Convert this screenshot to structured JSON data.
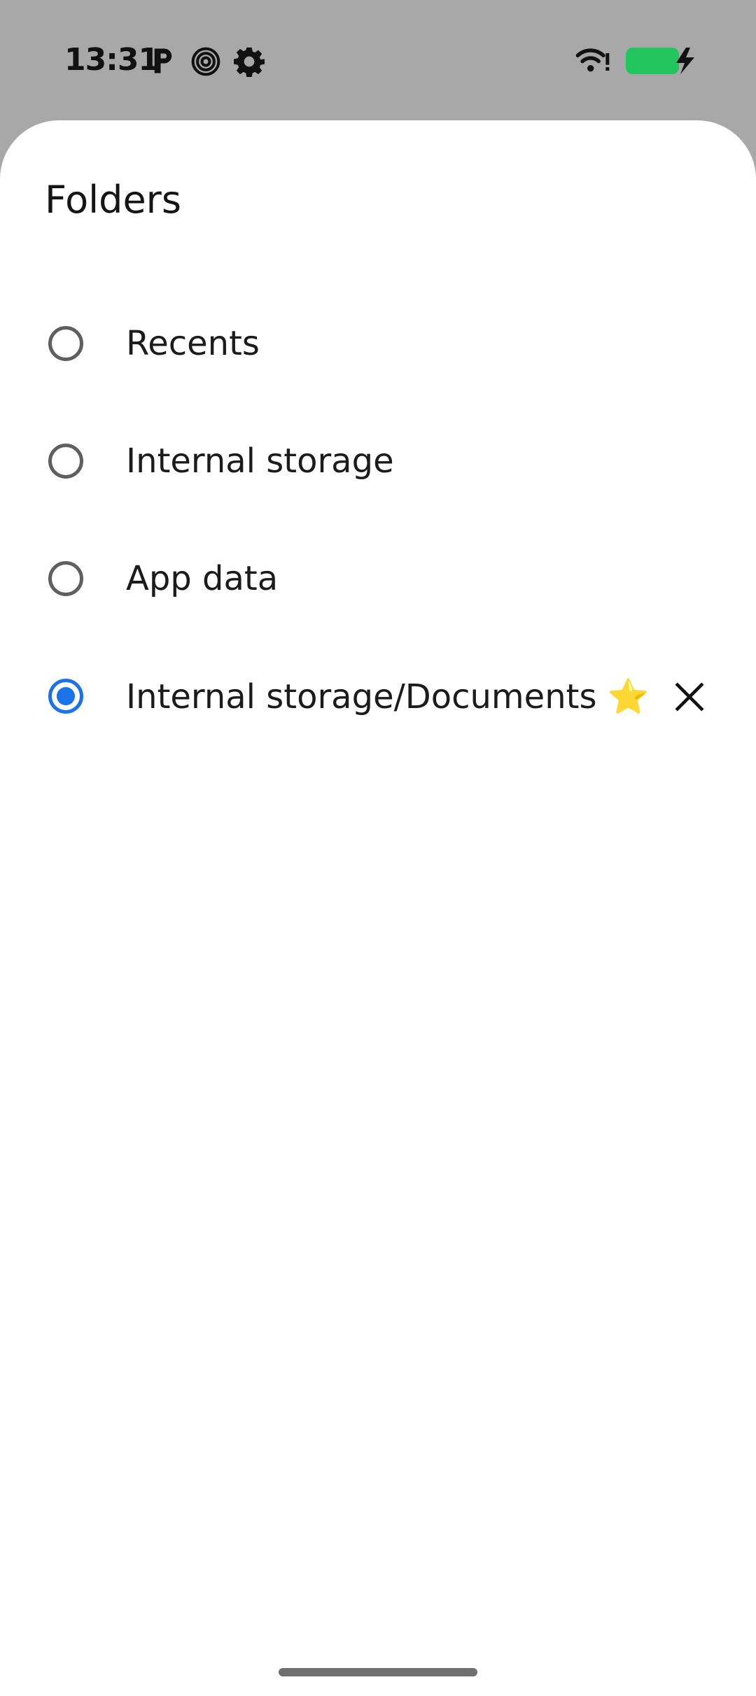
{
  "status_bar": {
    "time": "13:31",
    "icons": [
      "parking-icon",
      "spiral-icon",
      "gear-icon",
      "wifi-icon",
      "battery-charging-icon"
    ],
    "battery_color": "#22c55e"
  },
  "sheet": {
    "title": "Folders",
    "items": [
      {
        "label": "Recents",
        "selected": false
      },
      {
        "label": "Internal storage",
        "selected": false
      },
      {
        "label": "App data",
        "selected": false
      },
      {
        "label": "Internal storage/Documents ⭐",
        "selected": true,
        "removable": true
      }
    ]
  },
  "colors": {
    "accent": "#1a73e8",
    "scrim": "#a9a8a9"
  }
}
